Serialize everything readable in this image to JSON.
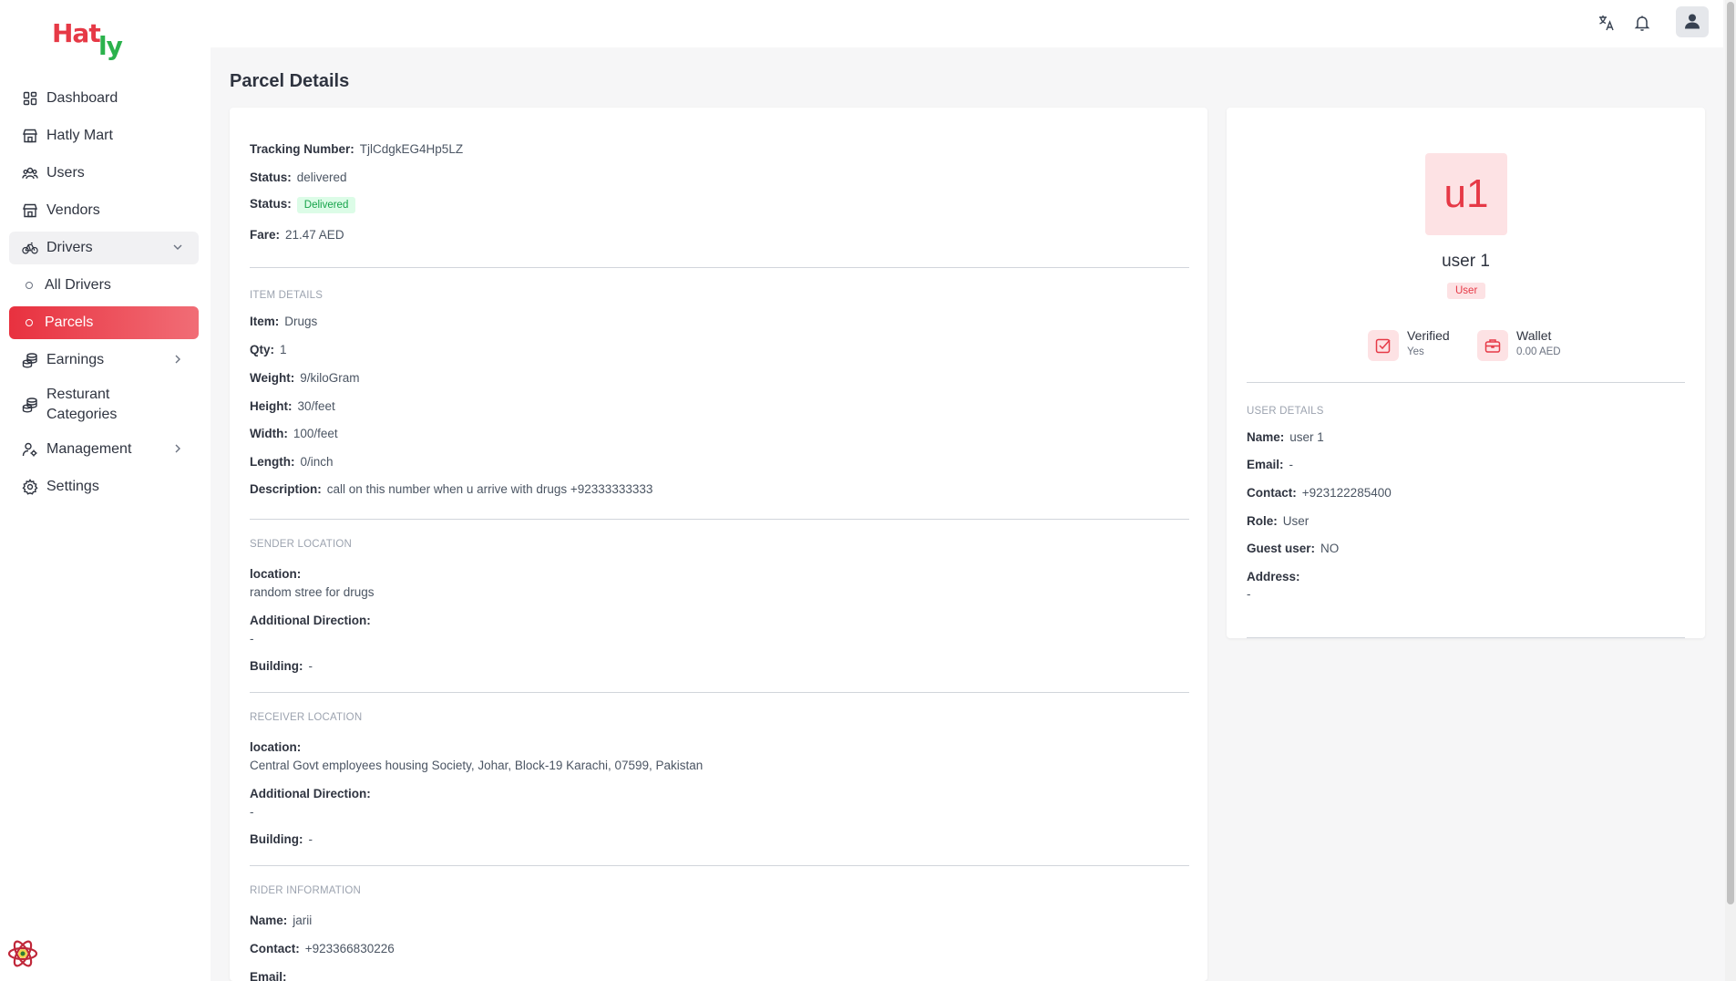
{
  "app": {
    "logo_part1": "Hat",
    "logo_part2": "ly"
  },
  "sidebar": {
    "items": [
      {
        "label": "Dashboard"
      },
      {
        "label": "Hatly Mart"
      },
      {
        "label": "Users"
      },
      {
        "label": "Vendors"
      },
      {
        "label": "Drivers"
      },
      {
        "label": "All Drivers"
      },
      {
        "label": "Parcels"
      },
      {
        "label": "Earnings"
      },
      {
        "label": "Resturant Categories"
      },
      {
        "label": "Management"
      },
      {
        "label": "Settings"
      }
    ]
  },
  "page": {
    "title": "Parcel Details"
  },
  "parcel": {
    "tracking_label": "Tracking Number:",
    "tracking_value": "TjlCdgkEG4Hp5LZ",
    "status_label": "Status:",
    "status_value": "delivered",
    "status2_label": "Status:",
    "status2_badge": "Delivered",
    "fare_label": "Fare:",
    "fare_value": "21.47 AED"
  },
  "item_details": {
    "heading": "ITEM DETAILS",
    "item_label": "Item:",
    "item_value": "Drugs",
    "qty_label": "Qty:",
    "qty_value": "1",
    "weight_label": "Weight:",
    "weight_value": "9/kiloGram",
    "height_label": "Height:",
    "height_value": "30/feet",
    "width_label": "Width:",
    "width_value": "100/feet",
    "length_label": "Length:",
    "length_value": "0/inch",
    "description_label": "Description:",
    "description_value": "call on this number when u arrive with drugs +92333333333"
  },
  "sender": {
    "heading": "SENDER LOCATION",
    "location_label": "location:",
    "location_value": "random stree for drugs",
    "direction_label": "Additional Direction:",
    "direction_value": "-",
    "building_label": "Building:",
    "building_value": "-"
  },
  "receiver": {
    "heading": "RECEIVER LOCATION",
    "location_label": "location:",
    "location_value": "Central Govt employees housing Society, Johar, Block-19 Karachi, 07599, Pakistan",
    "direction_label": "Additional Direction:",
    "direction_value": "-",
    "building_label": "Building:",
    "building_value": "-"
  },
  "rider": {
    "heading": "RIDER INFORMATION",
    "name_label": "Name:",
    "name_value": "jarii",
    "contact_label": "Contact:",
    "contact_value": "+923366830226",
    "email_label": "Email:"
  },
  "user_card": {
    "initials": "u1",
    "name": "user 1",
    "role_badge": "User",
    "verified_label": "Verified",
    "verified_value": "Yes",
    "wallet_label": "Wallet",
    "wallet_value": "0.00 AED",
    "details_heading": "USER DETAILS",
    "name_label": "Name:",
    "name_value": "user 1",
    "email_label": "Email:",
    "email_value": "-",
    "contact_label": "Contact:",
    "contact_value": "+923122285400",
    "role_label": "Role:",
    "role_value": "User",
    "guest_label": "Guest user:",
    "guest_value": "NO",
    "address_label": "Address:",
    "address_value": "-"
  },
  "colors": {
    "accent": "#e8313f",
    "logo_red": "#e63946",
    "logo_green": "#2bb24c",
    "success": "#16a34a"
  }
}
